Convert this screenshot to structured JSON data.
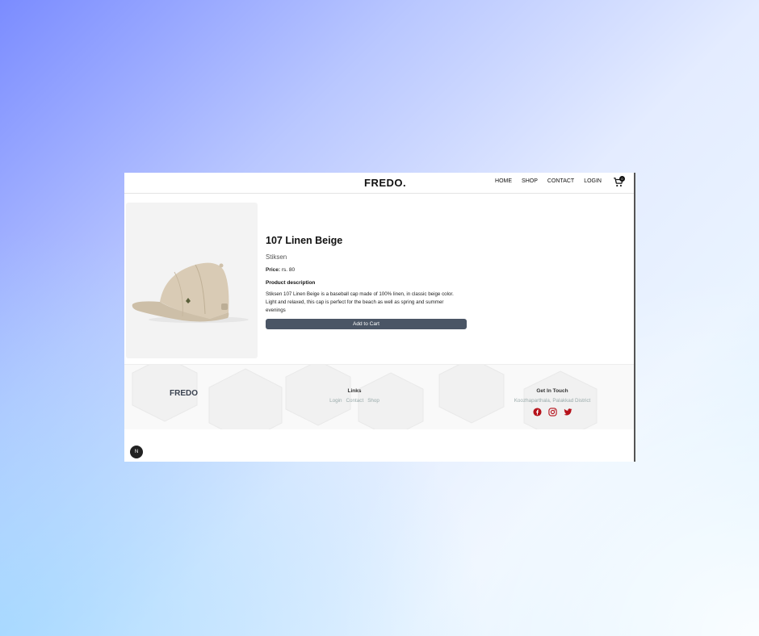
{
  "nav": {
    "brand": "FREDO.",
    "menu": [
      "HOME",
      "SHOP",
      "CONTACT",
      "LOGIN"
    ],
    "cart_count": "0",
    "icons": {
      "cart": "cart-icon"
    }
  },
  "product": {
    "title": "107 Linen Beige",
    "brand": "Stiksen",
    "price_label": "Price:",
    "price_value": "rs. 80",
    "description_heading": "Product description",
    "description": "Stiksen 107 Linen Beige is a baseball cap made of 100% linen, in classic beige color. Light and relaxed, this cap is perfect for the beach as well as spring and summer evenings",
    "add_to_cart": "Add to Cart"
  },
  "footer": {
    "brand": "FREDO",
    "links_heading": "Links",
    "links": [
      "Login",
      "Contact",
      "Shop"
    ],
    "contact_heading": "Get In Touch",
    "address": "Koozhaparthala, Palakkad District",
    "social_icons": [
      "facebook-icon",
      "instagram-icon",
      "twitter-icon"
    ],
    "social_color": "#b5121b"
  },
  "misc": {
    "n_badge": "N"
  },
  "colors": {
    "button": "#4a5565",
    "text_dark": "#111111"
  }
}
